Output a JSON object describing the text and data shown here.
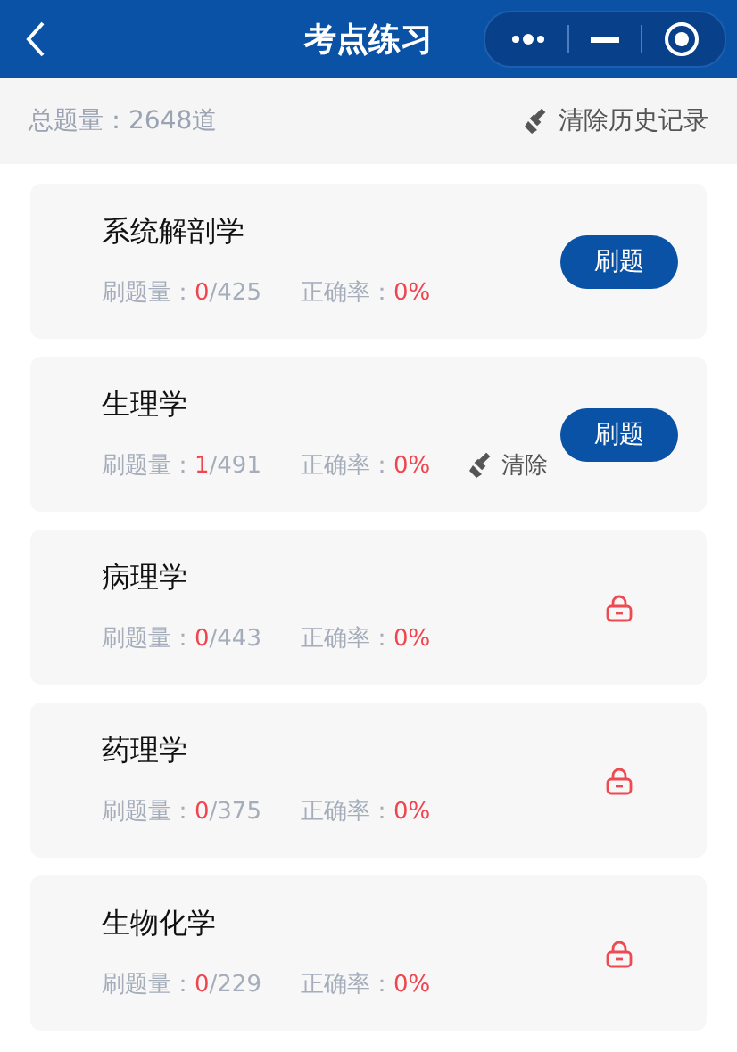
{
  "header": {
    "title": "考点练习"
  },
  "summary": {
    "total": "总题量：2648道",
    "clear_all": "清除历史记录"
  },
  "subjects": [
    {
      "name": "系统解剖学",
      "kind": "open",
      "count_label": "刷题量：",
      "done": "0",
      "total": "/425",
      "rate_label": "正确率：",
      "rate": "0%",
      "button": "刷题"
    },
    {
      "name": "生理学",
      "kind": "open",
      "count_label": "刷题量：",
      "done": "1",
      "total": "/491",
      "rate_label": "正确率：",
      "rate": "0%",
      "clear": "清除",
      "button": "刷题"
    },
    {
      "name": "病理学",
      "kind": "locked",
      "count_label": "刷题量：",
      "done": "0",
      "total": "/443",
      "rate_label": "正确率：",
      "rate": "0%"
    },
    {
      "name": "药理学",
      "kind": "locked",
      "count_label": "刷题量：",
      "done": "0",
      "total": "/375",
      "rate_label": "正确率：",
      "rate": "0%"
    },
    {
      "name": "生物化学",
      "kind": "locked",
      "count_label": "刷题量：",
      "done": "0",
      "total": "/229",
      "rate_label": "正确率：",
      "rate": "0%"
    }
  ]
}
